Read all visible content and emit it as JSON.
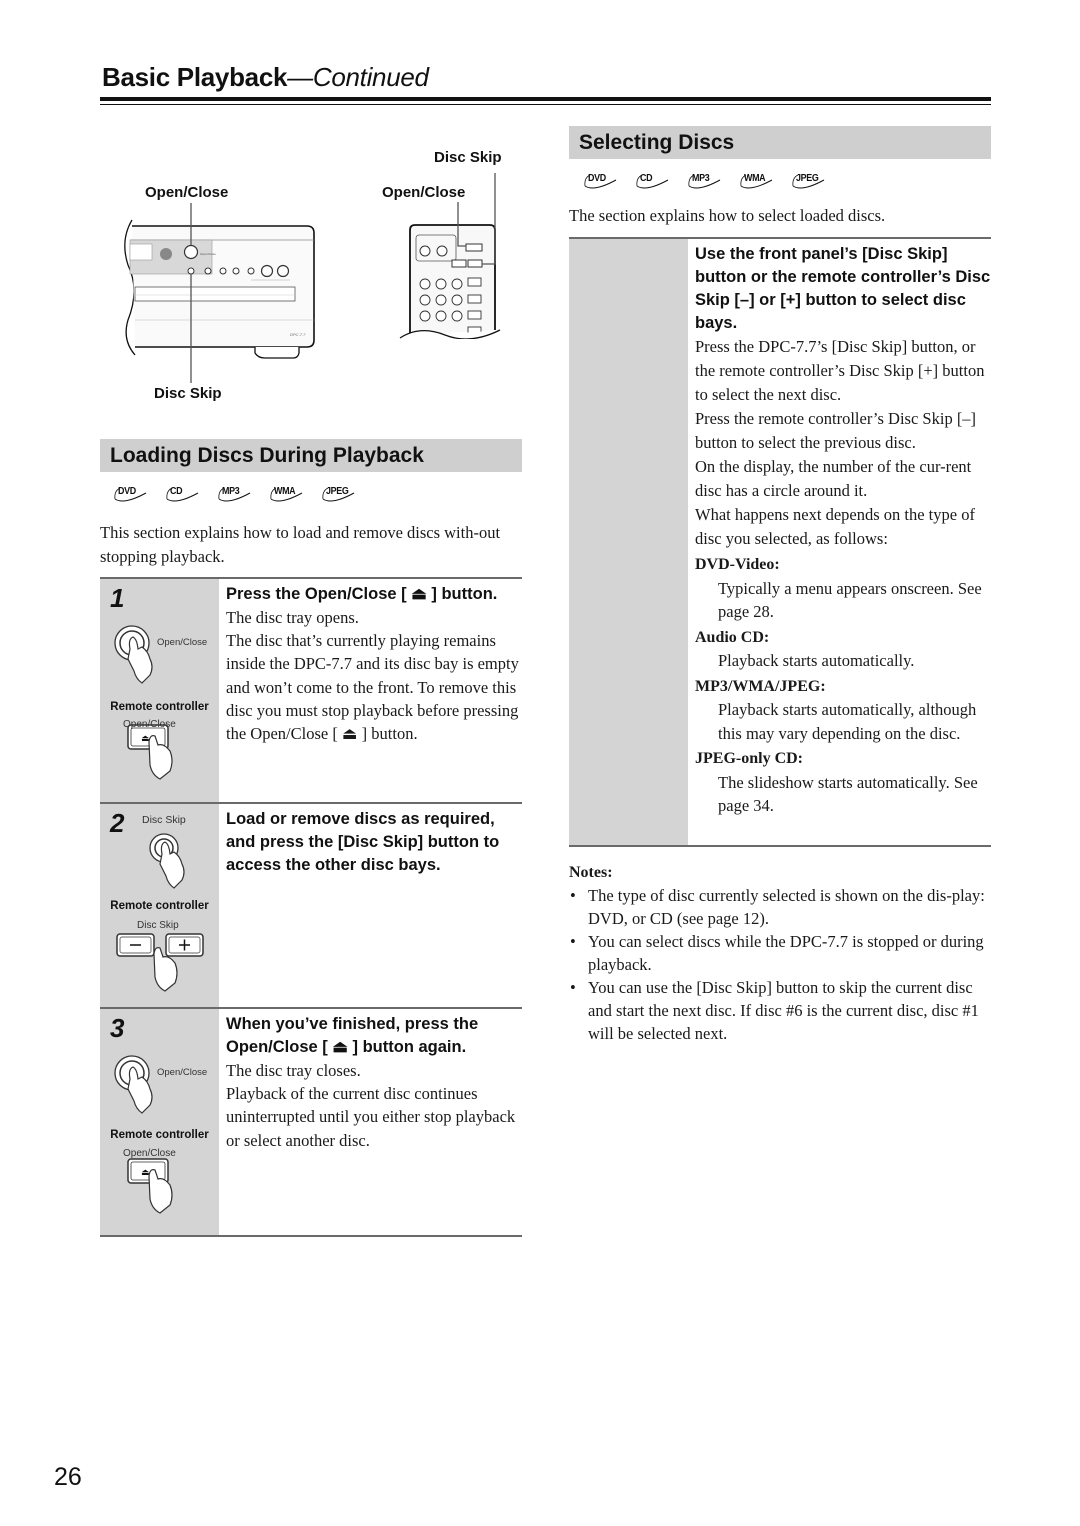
{
  "header": {
    "title": "Basic Playback",
    "continued": "—Continued"
  },
  "illustration": {
    "unit_open_close": "Open/Close",
    "unit_disc_skip": "Disc Skip",
    "remote_disc_skip": "Disc Skip",
    "remote_open_close": "Open/Close",
    "model_label": "DPC-7.7"
  },
  "loading": {
    "heading": "Loading Discs During Playback",
    "disc_types": [
      "DVD",
      "CD",
      "MP3",
      "WMA",
      "JPEG"
    ],
    "intro": "This section explains how to load and remove discs with-out stopping playback.",
    "steps": [
      {
        "number": "1",
        "title": "Press the Open/Close [ ⏏ ] button.",
        "unit_button_label": "Open/Close",
        "remote_label": "Remote controller",
        "remote_button_label": "Open/Close",
        "paragraphs": [
          "The disc tray opens.",
          "The disc that’s currently playing remains inside the DPC-7.7 and its disc bay is empty and won’t come to the front. To remove this disc you must stop playback before pressing the Open/Close [ ⏏ ] button."
        ]
      },
      {
        "number": "2",
        "title": "Load or remove discs as required, and press the [Disc Skip] button to access the other disc bays.",
        "unit_button_label": "Disc Skip",
        "remote_label": "Remote controller",
        "remote_button_label": "Disc Skip",
        "paragraphs": []
      },
      {
        "number": "3",
        "title": "When you’ve finished, press the Open/Close [ ⏏ ] button again.",
        "unit_button_label": "Open/Close",
        "remote_label": "Remote controller",
        "remote_button_label": "Open/Close",
        "paragraphs": [
          "The disc tray closes.",
          "Playback of the current disc continues uninterrupted until you either stop playback or select another disc."
        ]
      }
    ]
  },
  "selecting": {
    "heading": "Selecting Discs",
    "disc_types": [
      "DVD",
      "CD",
      "MP3",
      "WMA",
      "JPEG"
    ],
    "intro": "The section explains how to select loaded discs.",
    "title": "Use the front panel’s [Disc Skip] button or the remote controller’s Disc Skip [–] or [+] button to select disc bays.",
    "paragraphs": [
      "Press the DPC-7.7’s [Disc Skip] button, or the remote controller’s Disc Skip [+] button to select the next disc.",
      "Press the remote controller’s Disc Skip [–] button to select the previous disc.",
      "On the display, the number of the cur-rent disc has a circle around it.",
      "What happens next depends on the type of disc you selected, as follows:"
    ],
    "definitions": [
      {
        "term": "DVD-Video:",
        "desc": "Typically a menu appears onscreen. See page 28."
      },
      {
        "term": "Audio CD:",
        "desc": "Playback starts automatically."
      },
      {
        "term": "MP3/WMA/JPEG:",
        "desc": "Playback starts automatically, although this may vary depending on the disc."
      },
      {
        "term": "JPEG-only CD:",
        "desc": "The slideshow starts automatically. See page 34."
      }
    ]
  },
  "notes": {
    "title": "Notes:",
    "items": [
      "The type of disc currently selected is shown on the dis-play: DVD, or CD (see page 12).",
      "You can select discs while the DPC-7.7 is stopped or during playback.",
      "You can use the [Disc Skip] button to skip the current disc and start the next disc. If disc #6 is the current disc, disc #1 will be selected next."
    ]
  },
  "page_number": "26"
}
